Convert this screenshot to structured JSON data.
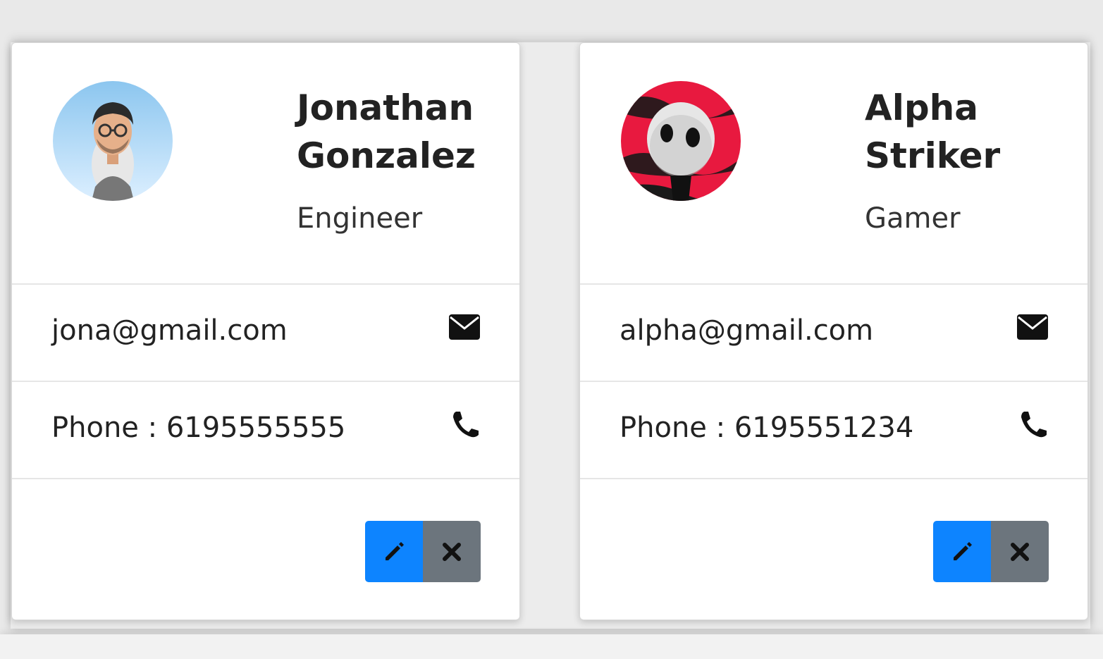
{
  "contacts": [
    {
      "name_line1": "Jonathan",
      "name_line2": "Gonzalez",
      "role": "Engineer",
      "email": "jona@gmail.com",
      "phone": "Phone : 6195555555",
      "avatar_icon": "memoji-avatar-icon"
    },
    {
      "name_line1": "Alpha",
      "name_line2": "Striker",
      "role": "Gamer",
      "email": "alpha@gmail.com",
      "phone": "Phone : 6195551234",
      "avatar_icon": "alien-avatar-icon"
    }
  ],
  "icons": {
    "email": "envelope-icon",
    "phone": "phone-icon",
    "edit": "pencil-icon",
    "delete": "close-icon"
  },
  "colors": {
    "edit_button": "#0d84ff",
    "delete_button": "#6c757d",
    "background": "#e9e9e9"
  }
}
